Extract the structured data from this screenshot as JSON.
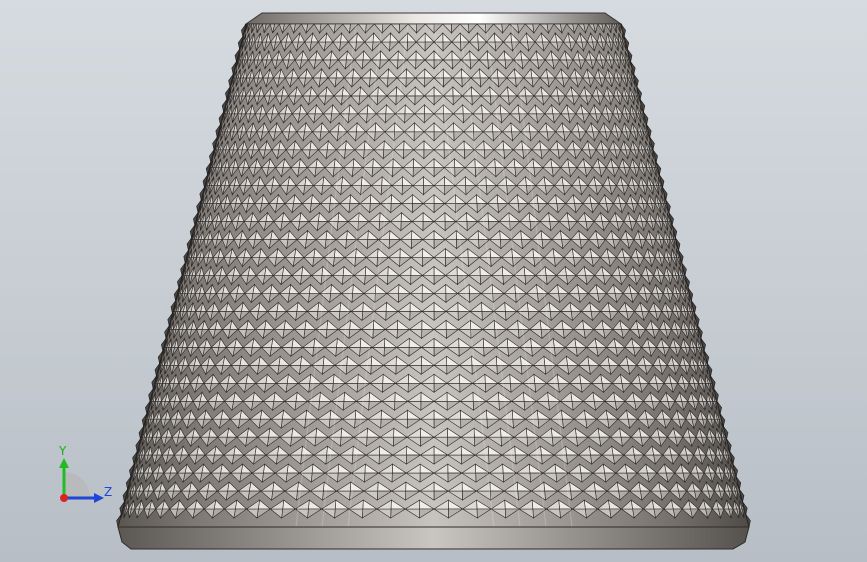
{
  "viewport": {
    "background_top": "#d6dbe0",
    "background_bottom": "#b7bec6"
  },
  "model": {
    "name": "knurled-frustum",
    "surface_color": "#9a9590",
    "edge_color": "#2a2725",
    "highlight_color": "#f2f0ee"
  },
  "triad": {
    "y_label": "Y",
    "z_label": "Z",
    "y_color": "#22bb22",
    "z_color": "#1e46d8",
    "origin_color": "#dd2222"
  }
}
